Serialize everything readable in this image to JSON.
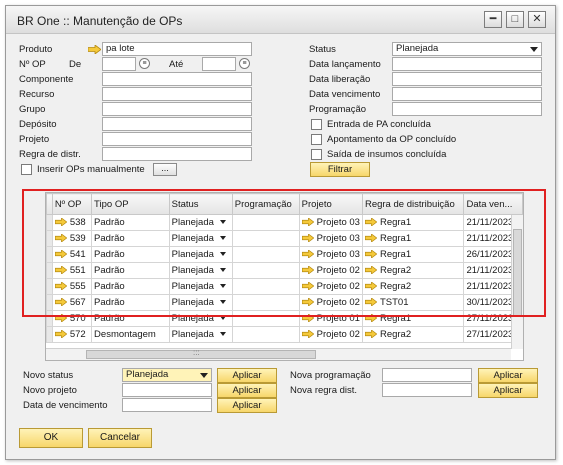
{
  "window": {
    "title": "BR One :: Manutenção de OPs"
  },
  "filters": {
    "produto_label": "Produto",
    "produto_value": "pa lote",
    "nop_label": "Nº OP",
    "de_label": "De",
    "ate_label": "Até",
    "componente_label": "Componente",
    "recurso_label": "Recurso",
    "grupo_label": "Grupo",
    "deposito_label": "Depósito",
    "projeto_label": "Projeto",
    "regra_label": "Regra de distr.",
    "inserir_label": "Inserir OPs manualmente",
    "ellipsis": "...",
    "status_label": "Status",
    "status_value": "Planejada",
    "data_lancamento_label": "Data lançamento",
    "data_liberacao_label": "Data liberação",
    "data_vencimento_label": "Data vencimento",
    "programacao_label": "Programação",
    "chk_pa_label": "Entrada de PA concluída",
    "chk_apont_label": "Apontamento da OP concluído",
    "chk_saida_label": "Saída de insumos concluída",
    "filtrar_label": "Filtrar"
  },
  "grid": {
    "columns": [
      "Nº OP",
      "Tipo OP",
      "Status",
      "Programação",
      "Projeto",
      "Regra de distribuição",
      "Data ven..."
    ],
    "rows": [
      [
        "538",
        "Padrão",
        "Planejada",
        "",
        "Projeto 03",
        "Regra1",
        "21/11/2023"
      ],
      [
        "539",
        "Padrão",
        "Planejada",
        "",
        "Projeto 03",
        "Regra1",
        "21/11/2023"
      ],
      [
        "541",
        "Padrão",
        "Planejada",
        "",
        "Projeto 03",
        "Regra1",
        "26/11/2023"
      ],
      [
        "551",
        "Padrão",
        "Planejada",
        "",
        "Projeto 02",
        "Regra2",
        "21/11/2023"
      ],
      [
        "555",
        "Padrão",
        "Planejada",
        "",
        "Projeto 02",
        "Regra2",
        "21/11/2023"
      ],
      [
        "567",
        "Padrão",
        "Planejada",
        "",
        "Projeto 02",
        "TST01",
        "30/11/2023"
      ],
      [
        "570",
        "Padrão",
        "Planejada",
        "",
        "Projeto 01",
        "Regra1",
        "27/11/2023"
      ],
      [
        "572",
        "Desmontagem",
        "Planejada",
        "",
        "Projeto 02",
        "Regra2",
        "27/11/2023"
      ]
    ],
    "hscroll_marker": ":::"
  },
  "actions": {
    "novo_status_label": "Novo status",
    "novo_status_value": "Planejada",
    "novo_projeto_label": "Novo projeto",
    "data_vencimento_label": "Data de vencimento",
    "nova_programacao_label": "Nova programação",
    "nova_regra_label": "Nova regra dist.",
    "aplicar_label": "Aplicar"
  },
  "footer": {
    "ok_label": "OK",
    "cancel_label": "Cancelar"
  },
  "colors": {
    "accent_arrow": "#f2c230",
    "highlight_border": "#e02020",
    "button_yellow": "#f7d66a"
  },
  "icons": {
    "link_arrow": "link-arrow-icon",
    "minimize": "minimize-icon",
    "maximize": "maximize-icon",
    "close": "close-icon",
    "calendar": "calendar-icon"
  }
}
